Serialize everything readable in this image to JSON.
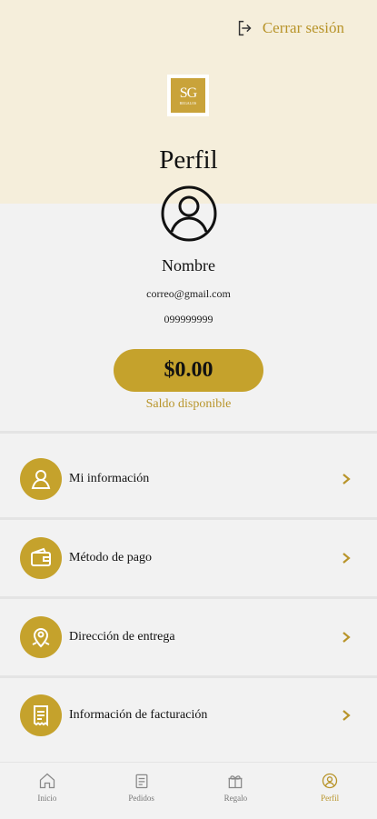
{
  "header": {
    "logout_label": "Cerrar sesión",
    "logo_text": "SG",
    "logo_subtext": "REGALOS",
    "title": "Perfil"
  },
  "profile": {
    "name": "Nombre",
    "email": "correo@gmail.com",
    "phone": "099999999",
    "balance": "$0.00",
    "balance_label": "Saldo disponible"
  },
  "menu": [
    {
      "label": "Mi información",
      "icon": "user-icon"
    },
    {
      "label": "Método de pago",
      "icon": "wallet-icon"
    },
    {
      "label": "Dirección de entrega",
      "icon": "location-pin-icon"
    },
    {
      "label": "Información de facturación",
      "icon": "invoice-icon"
    }
  ],
  "bottom_nav": [
    {
      "label": "Inicio",
      "icon": "home-icon",
      "active": false
    },
    {
      "label": "Pedidos",
      "icon": "orders-icon",
      "active": false
    },
    {
      "label": "Regalo",
      "icon": "gift-icon",
      "active": false
    },
    {
      "label": "Perfil",
      "icon": "profile-icon",
      "active": true
    }
  ],
  "colors": {
    "accent": "#c5a22c",
    "accent_text": "#b8942a",
    "header_bg": "#f5eedb",
    "page_bg": "#f2f2f2"
  }
}
